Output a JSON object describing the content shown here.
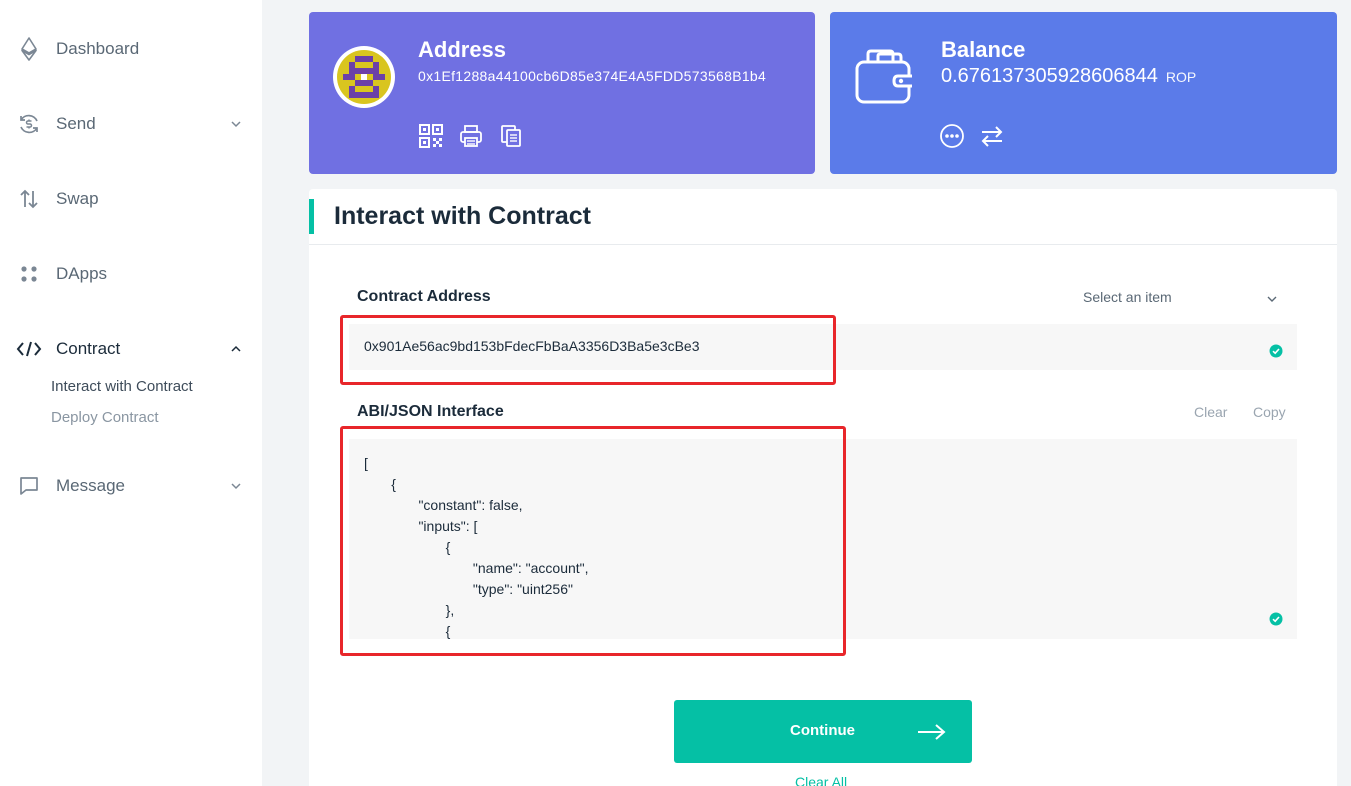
{
  "sidebar": {
    "items": [
      {
        "label": "Dashboard",
        "icon": "ethereum-icon"
      },
      {
        "label": "Send",
        "icon": "dollar-refresh-icon"
      },
      {
        "label": "Swap",
        "icon": "swap-arrows-icon"
      },
      {
        "label": "DApps",
        "icon": "grid-dots-icon"
      },
      {
        "label": "Contract",
        "icon": "code-icon"
      },
      {
        "label": "Message",
        "icon": "chat-bubble-icon"
      }
    ],
    "contract_sub": [
      "Interact with Contract",
      "Deploy Contract"
    ]
  },
  "address_card": {
    "title": "Address",
    "value": "0x1Ef1288a44100cb6D85e374E4A5FDD573568B1b4",
    "icons": [
      "qr-code-icon",
      "printer-icon",
      "copy-icon"
    ]
  },
  "balance_card": {
    "title": "Balance",
    "value": "0.676137305928606844",
    "unit": "ROP",
    "icons": [
      "more-icon",
      "transfer-icon"
    ]
  },
  "panel": {
    "title": "Interact with Contract",
    "contract_address_label": "Contract Address",
    "select_placeholder": "Select an item",
    "contract_address_value": "0x901Ae56ac9bd153bFdecFbBaA3356D3Ba5e3cBe3",
    "abi_label": "ABI/JSON Interface",
    "clear_label": "Clear",
    "copy_label": "Copy",
    "abi_value": "[\n       {\n              \"constant\": false,\n              \"inputs\": [\n                     {\n                            \"name\": \"account\",\n                            \"type\": \"uint256\"\n                     },\n                     {",
    "continue_label": "Continue",
    "clear_all_label": "Clear All"
  },
  "colors": {
    "accent": "#05c0a5",
    "address_card": "#7070e2",
    "balance_card": "#5b7be9",
    "highlight": "#e8262a"
  }
}
